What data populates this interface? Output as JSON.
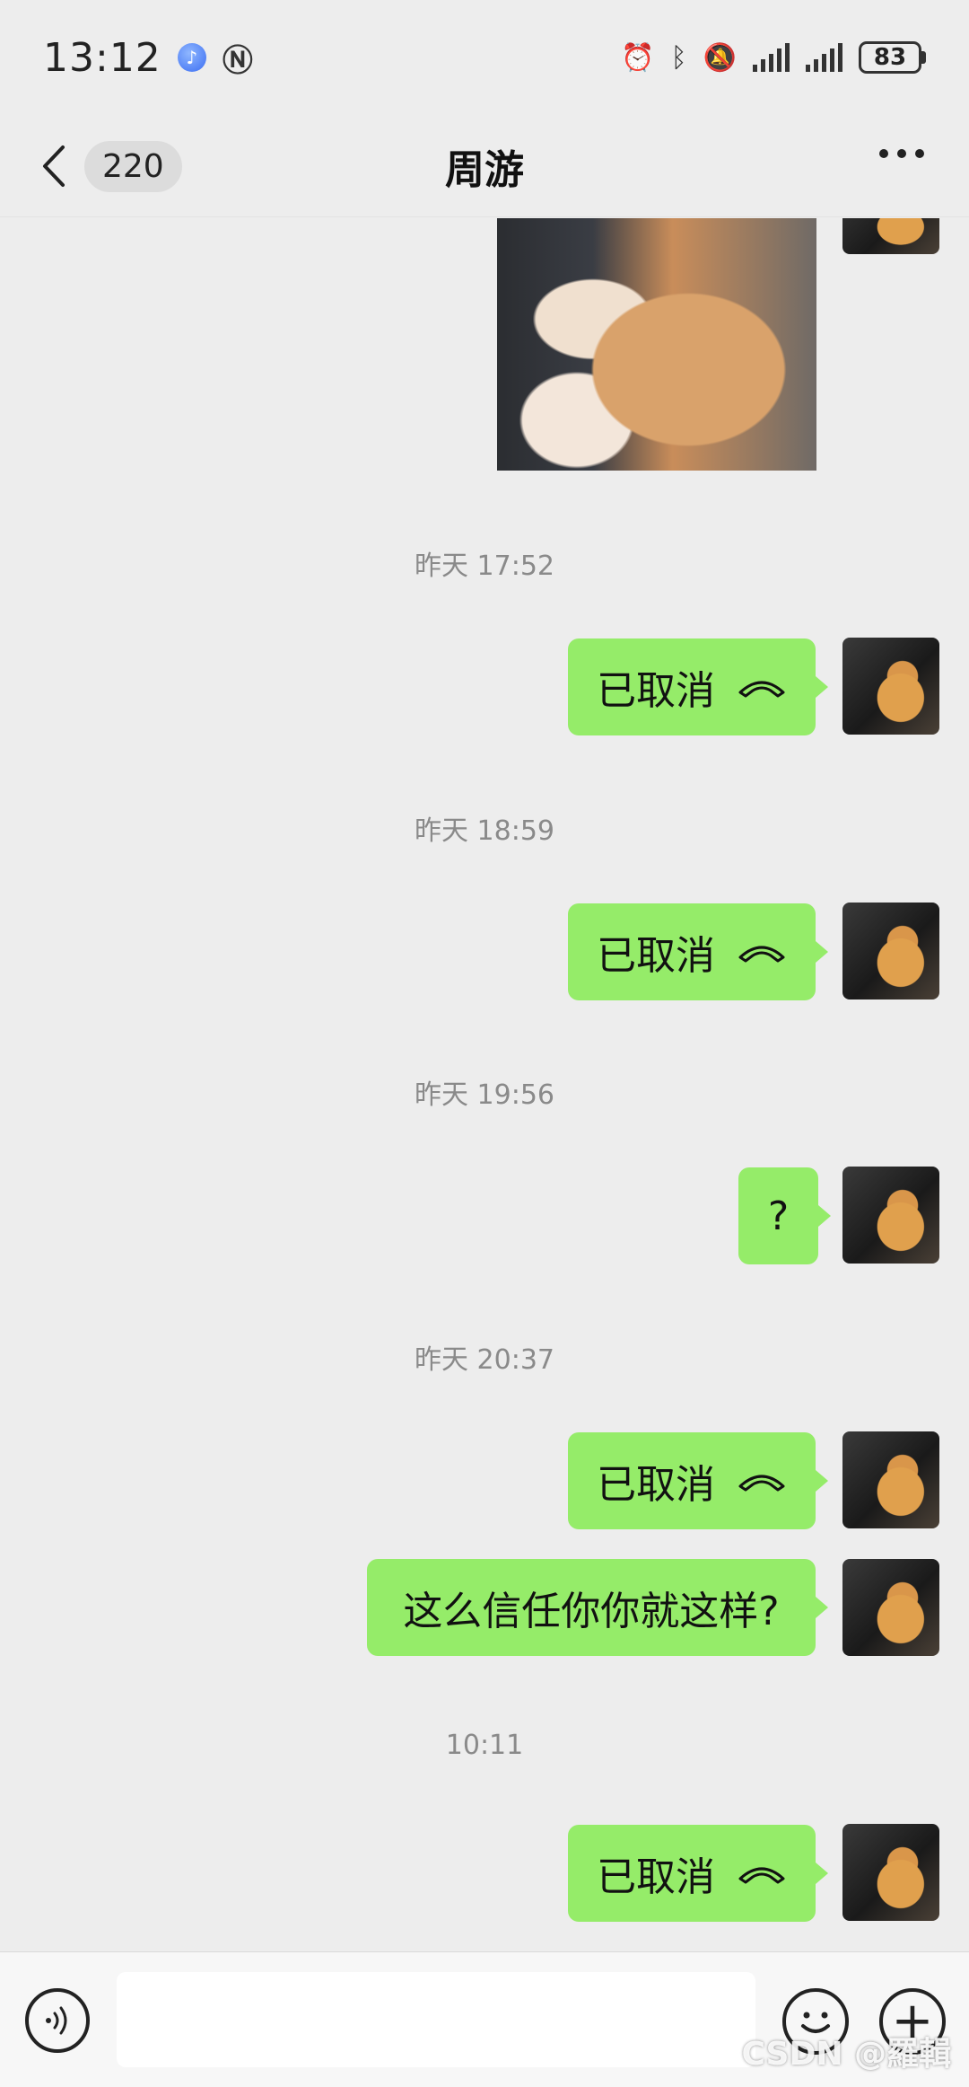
{
  "status_bar": {
    "time": "13:12",
    "battery": "83"
  },
  "header": {
    "unread_count": "220",
    "title": "周游"
  },
  "chat": {
    "timestamps": [
      "昨天 17:52",
      "昨天 18:59",
      "昨天 19:56",
      "昨天 20:37",
      "10:11"
    ],
    "messages": [
      {
        "text": "已取消",
        "type": "call"
      },
      {
        "text": "已取消",
        "type": "call"
      },
      {
        "text": "?",
        "type": "text"
      },
      {
        "text": "已取消",
        "type": "call"
      },
      {
        "text": "这么信任你你就这样?",
        "type": "text"
      },
      {
        "text": "已取消",
        "type": "call"
      }
    ]
  },
  "input": {
    "placeholder": ""
  },
  "watermark": "CSDN @羅輯",
  "colors": {
    "bubble": "#95ec69",
    "background": "#ededed"
  }
}
